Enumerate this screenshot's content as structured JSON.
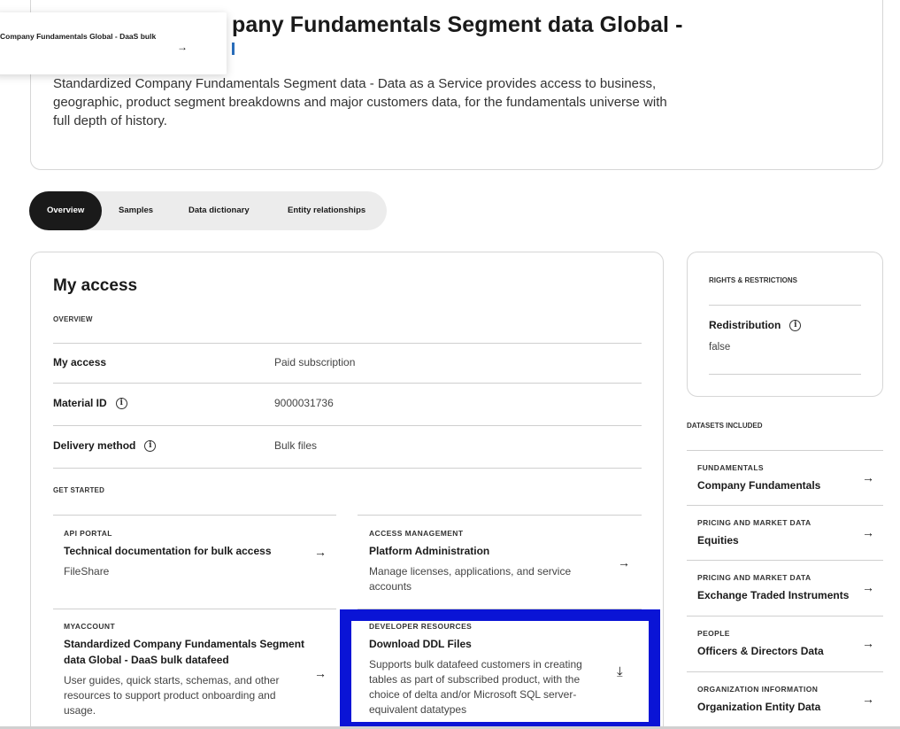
{
  "hero": {
    "title": "pany Fundamentals Segment data Global -",
    "description": "Standardized Company Fundamentals Segment data - Data as a Service provides access to business, geographic, product segment breakdowns and major customers data, for the fundamentals universe with full depth of history."
  },
  "floating_crumb": {
    "text": "Company Fundamentals Global - DaaS bulk",
    "arrow": "→"
  },
  "tabs": [
    {
      "label": "Overview",
      "active": true
    },
    {
      "label": "Samples",
      "active": false
    },
    {
      "label": "Data dictionary",
      "active": false
    },
    {
      "label": "Entity relationships",
      "active": false
    }
  ],
  "access": {
    "title": "My access",
    "overview_caption": "OVERVIEW",
    "rows": [
      {
        "label": "My access",
        "value": "Paid subscription",
        "info": false
      },
      {
        "label": "Material ID",
        "value": "9000031736",
        "info": true
      },
      {
        "label": "Delivery method",
        "value": "Bulk files",
        "info": true
      }
    ],
    "get_started_caption": "GET STARTED"
  },
  "info_glyph": "i",
  "resources": [
    {
      "caption": "API PORTAL",
      "title": "Technical documentation for bulk access",
      "description": "FileShare",
      "icon": "arrow-right",
      "glyph": "→"
    },
    {
      "caption": "ACCESS MANAGEMENT",
      "title": "Platform Administration",
      "description": "Manage licenses, applications, and service accounts",
      "icon": "arrow-right",
      "glyph": "→"
    },
    {
      "caption": "MYACCOUNT",
      "title": "Standardized Company Fundamentals Segment data Global - DaaS bulk datafeed",
      "description": "User guides, quick starts, schemas, and other resources to support product onboarding and usage.",
      "icon": "arrow-right",
      "glyph": "→"
    },
    {
      "caption": "DEVELOPER RESOURCES",
      "title": "Download DDL Files",
      "description": "Supports bulk datafeed customers in creating tables as part of subscribed product, with the choice of delta and/or Microsoft SQL server-equivalent datatypes",
      "icon": "download",
      "glyph": "⤓"
    }
  ],
  "rights": {
    "caption": "RIGHTS & RESTRICTIONS",
    "label": "Redistribution",
    "value": "false"
  },
  "datasets": {
    "caption": "DATASETS INCLUDED",
    "items": [
      {
        "category": "FUNDAMENTALS",
        "name": "Company Fundamentals"
      },
      {
        "category": "PRICING AND MARKET DATA",
        "name": "Equities"
      },
      {
        "category": "PRICING AND MARKET DATA",
        "name": "Exchange Traded Instruments"
      },
      {
        "category": "PEOPLE",
        "name": "Officers & Directors Data"
      },
      {
        "category": "ORGANIZATION INFORMATION",
        "name": "Organization Entity Data"
      }
    ],
    "arrow": "→"
  },
  "colors": {
    "highlight": "#0a14d6",
    "active_tab_bg": "#1a1a1a",
    "tabs_bg": "#ececec"
  }
}
